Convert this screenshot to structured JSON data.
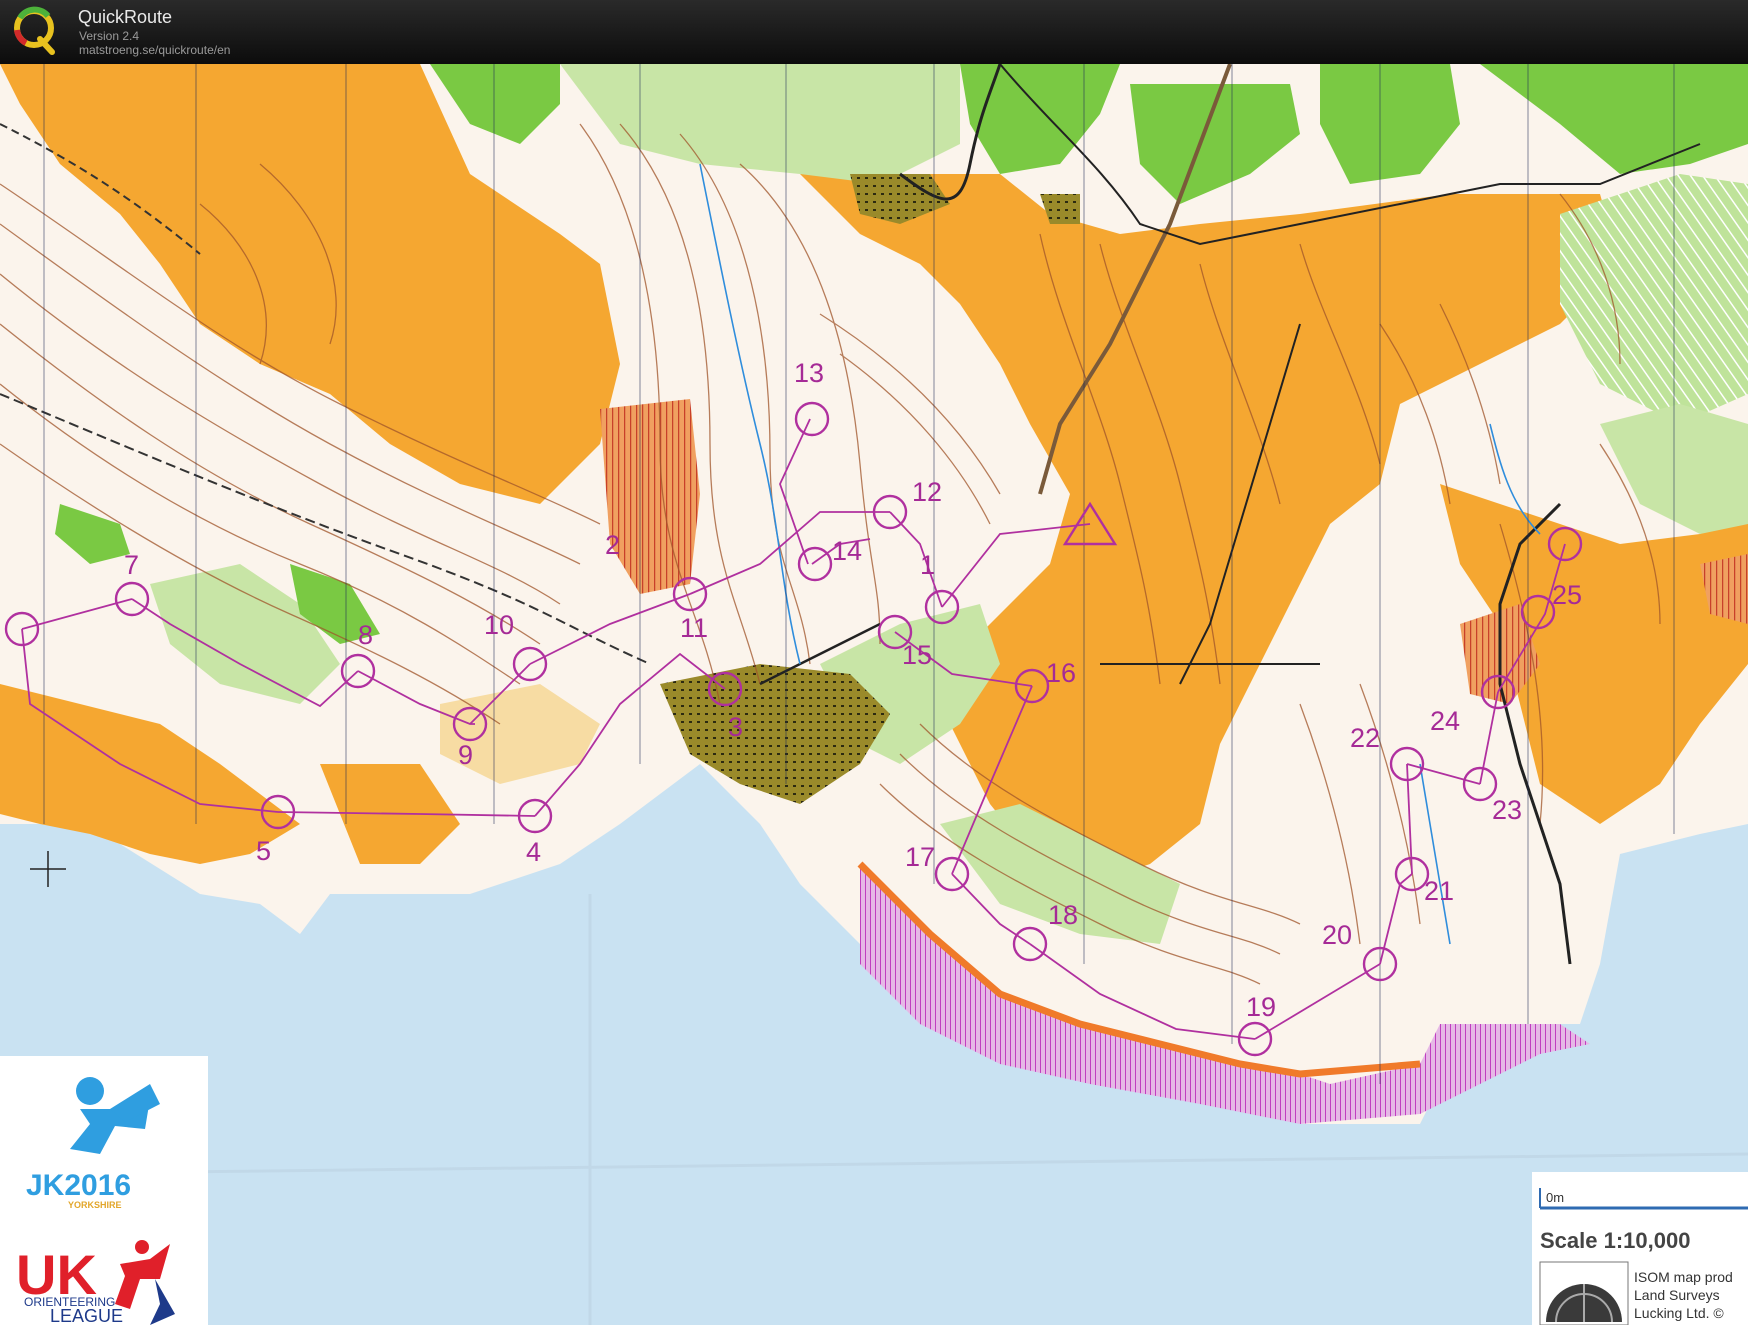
{
  "app": {
    "name": "QuickRoute",
    "version": "Version 2.4",
    "url": "matstroeng.se/quickroute/en"
  },
  "colors": {
    "open_land": "#f5a731",
    "forest": "#ffffff",
    "green_vegetation": "#7ac943",
    "light_green": "#c8e5a6",
    "rough_open": "#f7dca3",
    "sea": "#c9e2f2",
    "course_overprint": "#b0309f",
    "contour": "#a0552a",
    "settlement": "#8a7a1f",
    "out_of_bounds_red": "#d8533b"
  },
  "course": {
    "controls": [
      {
        "label": "1"
      },
      {
        "label": "2"
      },
      {
        "label": "3"
      },
      {
        "label": "4"
      },
      {
        "label": "5"
      },
      {
        "label": "7"
      },
      {
        "label": "8"
      },
      {
        "label": "9"
      },
      {
        "label": "10"
      },
      {
        "label": "11"
      },
      {
        "label": "12"
      },
      {
        "label": "13"
      },
      {
        "label": "14"
      },
      {
        "label": "15"
      },
      {
        "label": "16"
      },
      {
        "label": "17"
      },
      {
        "label": "18"
      },
      {
        "label": "19"
      },
      {
        "label": "20"
      },
      {
        "label": "21"
      },
      {
        "label": "22"
      },
      {
        "label": "23"
      },
      {
        "label": "24"
      },
      {
        "label": "25"
      }
    ]
  },
  "map_info": {
    "scale_start": "0m",
    "scale": "Scale 1:10,000",
    "credits": [
      "ISOM map prod",
      "Land Surveys",
      "Lucking Ltd. ©"
    ]
  },
  "logos": {
    "event_logo": "JK2016",
    "event_region": "YORKSHIRE",
    "league_logo": "UK",
    "league_line1": "ORIENTEERING",
    "league_line2": "LEAGUE"
  }
}
